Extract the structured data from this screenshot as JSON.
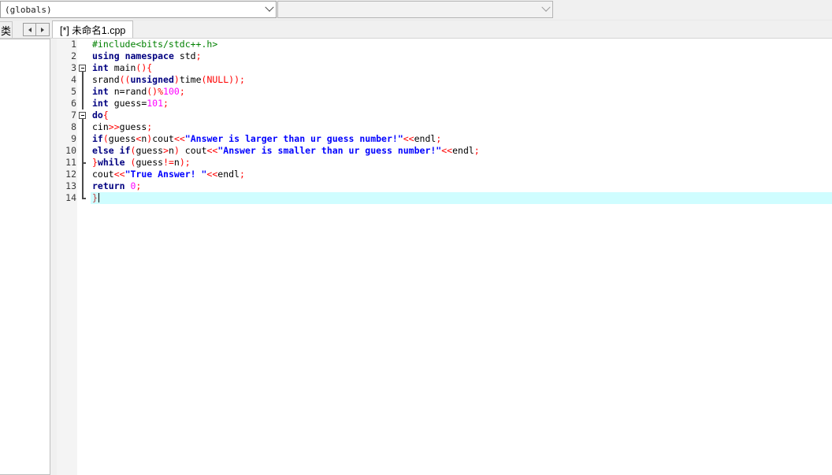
{
  "toolbar": {
    "scope_combo": {
      "value": "(globals)",
      "icon": "chevron-down-icon"
    },
    "member_combo": {
      "value": "",
      "icon": "chevron-down-icon"
    }
  },
  "tabs": {
    "tree_tab_label": "类",
    "nav_prev_icon": "triangle-left-icon",
    "nav_next_icon": "triangle-right-icon",
    "file_tab_label": "[*] 未命名1.cpp"
  },
  "editor": {
    "current_line": 14,
    "caret_line": 14,
    "colors": {
      "background": "#ffffff",
      "gutter": "#f4f4f4",
      "current_line_highlight": "#cffdff",
      "keyword": "#000080",
      "preprocessor": "#008000",
      "string": "#0000ff",
      "number": "#ff00ff",
      "operator": "#ff0000",
      "identifier": "#000000"
    },
    "lines": [
      {
        "number": "1",
        "fold": "none",
        "tokens": [
          {
            "t": "#include<bits/stdc++.h>",
            "c": "pp"
          }
        ]
      },
      {
        "number": "2",
        "fold": "none",
        "tokens": [
          {
            "t": "using",
            "c": "k"
          },
          {
            "t": " ",
            "c": "id"
          },
          {
            "t": "namespace",
            "c": "k"
          },
          {
            "t": " ",
            "c": "id"
          },
          {
            "t": "std",
            "c": "id"
          },
          {
            "t": ";",
            "c": "op"
          }
        ]
      },
      {
        "number": "3",
        "fold": "box-open",
        "tokens": [
          {
            "t": "int",
            "c": "k"
          },
          {
            "t": " main",
            "c": "id"
          },
          {
            "t": "()",
            "c": "op"
          },
          {
            "t": "{",
            "c": "op"
          }
        ]
      },
      {
        "number": "4",
        "fold": "line",
        "tokens": [
          {
            "t": "srand",
            "c": "id"
          },
          {
            "t": "((",
            "c": "op"
          },
          {
            "t": "unsigned",
            "c": "k"
          },
          {
            "t": ")",
            "c": "op"
          },
          {
            "t": "time",
            "c": "id"
          },
          {
            "t": "(",
            "c": "op"
          },
          {
            "t": "NULL",
            "c": "op"
          },
          {
            "t": "));",
            "c": "op"
          }
        ]
      },
      {
        "number": "5",
        "fold": "line",
        "tokens": [
          {
            "t": "int",
            "c": "k"
          },
          {
            "t": " n=rand",
            "c": "id"
          },
          {
            "t": "()",
            "c": "op"
          },
          {
            "t": "%",
            "c": "op"
          },
          {
            "t": "100",
            "c": "nm"
          },
          {
            "t": ";",
            "c": "op"
          }
        ]
      },
      {
        "number": "6",
        "fold": "line",
        "tokens": [
          {
            "t": "int",
            "c": "k"
          },
          {
            "t": " guess=",
            "c": "id"
          },
          {
            "t": "101",
            "c": "nm"
          },
          {
            "t": ";",
            "c": "op"
          }
        ]
      },
      {
        "number": "7",
        "fold": "box-open",
        "tokens": [
          {
            "t": "do",
            "c": "k"
          },
          {
            "t": "{",
            "c": "op"
          }
        ]
      },
      {
        "number": "8",
        "fold": "line",
        "tokens": [
          {
            "t": "cin",
            "c": "id"
          },
          {
            "t": ">>",
            "c": "op"
          },
          {
            "t": "guess",
            "c": "id"
          },
          {
            "t": ";",
            "c": "op"
          }
        ]
      },
      {
        "number": "9",
        "fold": "line",
        "tokens": [
          {
            "t": "if",
            "c": "k"
          },
          {
            "t": "(",
            "c": "op"
          },
          {
            "t": "guess",
            "c": "id"
          },
          {
            "t": "<",
            "c": "op"
          },
          {
            "t": "n",
            "c": "id"
          },
          {
            "t": ")",
            "c": "op"
          },
          {
            "t": "cout",
            "c": "id"
          },
          {
            "t": "<<",
            "c": "op"
          },
          {
            "t": "\"Answer is larger than ur guess number!\"",
            "c": "st"
          },
          {
            "t": "<<",
            "c": "op"
          },
          {
            "t": "endl",
            "c": "id"
          },
          {
            "t": ";",
            "c": "op"
          }
        ]
      },
      {
        "number": "10",
        "fold": "line",
        "tokens": [
          {
            "t": "else",
            "c": "k"
          },
          {
            "t": " ",
            "c": "id"
          },
          {
            "t": "if",
            "c": "k"
          },
          {
            "t": "(",
            "c": "op"
          },
          {
            "t": "guess",
            "c": "id"
          },
          {
            "t": ">",
            "c": "op"
          },
          {
            "t": "n",
            "c": "id"
          },
          {
            "t": ")",
            "c": "op"
          },
          {
            "t": " cout",
            "c": "id"
          },
          {
            "t": "<<",
            "c": "op"
          },
          {
            "t": "\"Answer is smaller than ur guess number!\"",
            "c": "st"
          },
          {
            "t": "<<",
            "c": "op"
          },
          {
            "t": "endl",
            "c": "id"
          },
          {
            "t": ";",
            "c": "op"
          }
        ]
      },
      {
        "number": "11",
        "fold": "tick",
        "tokens": [
          {
            "t": "}",
            "c": "op"
          },
          {
            "t": "while",
            "c": "k"
          },
          {
            "t": " ",
            "c": "id"
          },
          {
            "t": "(",
            "c": "op"
          },
          {
            "t": "guess",
            "c": "id"
          },
          {
            "t": "!=",
            "c": "op"
          },
          {
            "t": "n",
            "c": "id"
          },
          {
            "t": ");",
            "c": "op"
          }
        ]
      },
      {
        "number": "12",
        "fold": "line",
        "tokens": [
          {
            "t": "cout",
            "c": "id"
          },
          {
            "t": "<<",
            "c": "op"
          },
          {
            "t": "\"True Answer! \"",
            "c": "st"
          },
          {
            "t": "<<",
            "c": "op"
          },
          {
            "t": "endl",
            "c": "id"
          },
          {
            "t": ";",
            "c": "op"
          }
        ]
      },
      {
        "number": "13",
        "fold": "line",
        "tokens": [
          {
            "t": "return",
            "c": "k"
          },
          {
            "t": " ",
            "c": "id"
          },
          {
            "t": "0",
            "c": "nm"
          },
          {
            "t": ";",
            "c": "op"
          }
        ]
      },
      {
        "number": "14",
        "fold": "end",
        "caret": true,
        "tokens": [
          {
            "t": "}",
            "c": "br"
          }
        ]
      }
    ]
  }
}
